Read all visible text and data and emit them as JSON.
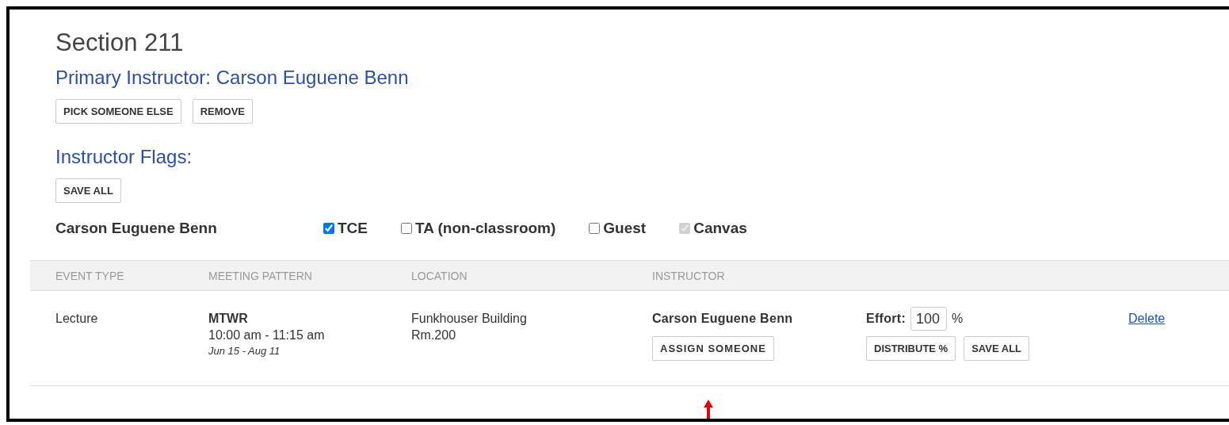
{
  "section_title": "Section 211",
  "primary_instructor": "Primary Instructor: Carson Euguene Benn",
  "instructor_buttons": [
    "PICK SOMEONE ELSE",
    "REMOVE"
  ],
  "flags_heading": "Instructor Flags:",
  "flags_save_button": "SAVE ALL",
  "flag_row": {
    "name": "Carson Euguene Benn",
    "flags": [
      {
        "label": "TCE",
        "checked": true,
        "disabled": false
      },
      {
        "label": "TA (non-classroom)",
        "checked": false,
        "disabled": false
      },
      {
        "label": "Guest",
        "checked": false,
        "disabled": false
      },
      {
        "label": "Canvas",
        "checked": true,
        "disabled": true
      }
    ]
  },
  "table": {
    "columns": [
      "EVENT TYPE",
      "MEETING PATTERN",
      "LOCATION",
      "INSTRUCTOR"
    ],
    "rows": [
      {
        "event_type": "Lecture",
        "days": "MTWR",
        "time": "10:00 am - 11:15 am",
        "dates": "Jun 15 - Aug 11",
        "location": [
          "Funkhouser Building",
          "Rm.200"
        ],
        "instructor": "Carson Euguene Benn",
        "assign_button": "ASSIGN SOMEONE",
        "effort_label": "Effort:",
        "effort_value": "100",
        "effort_unit": "%",
        "effort_buttons": [
          "DISTRIBUTE %",
          "SAVE ALL"
        ],
        "delete_link": "Delete"
      }
    ]
  }
}
